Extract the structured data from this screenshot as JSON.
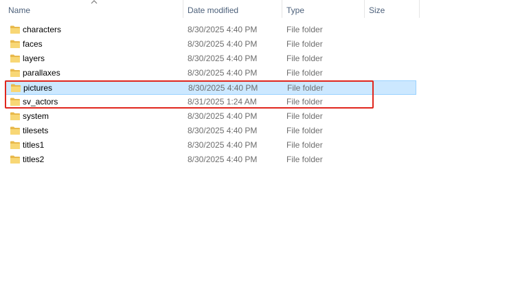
{
  "columns": {
    "name": "Name",
    "date_modified": "Date modified",
    "type": "Type",
    "size": "Size"
  },
  "sort": {
    "column": "name",
    "direction": "ascending",
    "icon": "chevron-up-icon"
  },
  "files": [
    {
      "name": "characters",
      "date": "8/30/2025 4:40 PM",
      "type": "File folder",
      "size": "",
      "selected": false,
      "icon": "folder-icon"
    },
    {
      "name": "faces",
      "date": "8/30/2025 4:40 PM",
      "type": "File folder",
      "size": "",
      "selected": false,
      "icon": "folder-icon"
    },
    {
      "name": "layers",
      "date": "8/30/2025 4:40 PM",
      "type": "File folder",
      "size": "",
      "selected": false,
      "icon": "folder-icon"
    },
    {
      "name": "parallaxes",
      "date": "8/30/2025 4:40 PM",
      "type": "File folder",
      "size": "",
      "selected": false,
      "icon": "folder-icon"
    },
    {
      "name": "pictures",
      "date": "8/30/2025 4:40 PM",
      "type": "File folder",
      "size": "",
      "selected": true,
      "icon": "folder-icon"
    },
    {
      "name": "sv_actors",
      "date": "8/31/2025 1:24 AM",
      "type": "File folder",
      "size": "",
      "selected": false,
      "icon": "folder-icon"
    },
    {
      "name": "system",
      "date": "8/30/2025 4:40 PM",
      "type": "File folder",
      "size": "",
      "selected": false,
      "icon": "folder-icon"
    },
    {
      "name": "tilesets",
      "date": "8/30/2025 4:40 PM",
      "type": "File folder",
      "size": "",
      "selected": false,
      "icon": "folder-icon"
    },
    {
      "name": "titles1",
      "date": "8/30/2025 4:40 PM",
      "type": "File folder",
      "size": "",
      "selected": false,
      "icon": "folder-icon"
    },
    {
      "name": "titles2",
      "date": "8/30/2025 4:40 PM",
      "type": "File folder",
      "size": "",
      "selected": false,
      "icon": "folder-icon"
    }
  ],
  "annotation": {
    "type": "highlight-box",
    "color": "#e0251c",
    "covers": [
      "pictures",
      "sv_actors"
    ]
  },
  "colors": {
    "selection_bg": "#cce8ff",
    "selection_border": "#99d1ff",
    "header_text": "#4c607a",
    "secondary_text": "#6d6d6d",
    "folder_yellow": "#f8d775",
    "folder_dark": "#e8b84a"
  }
}
